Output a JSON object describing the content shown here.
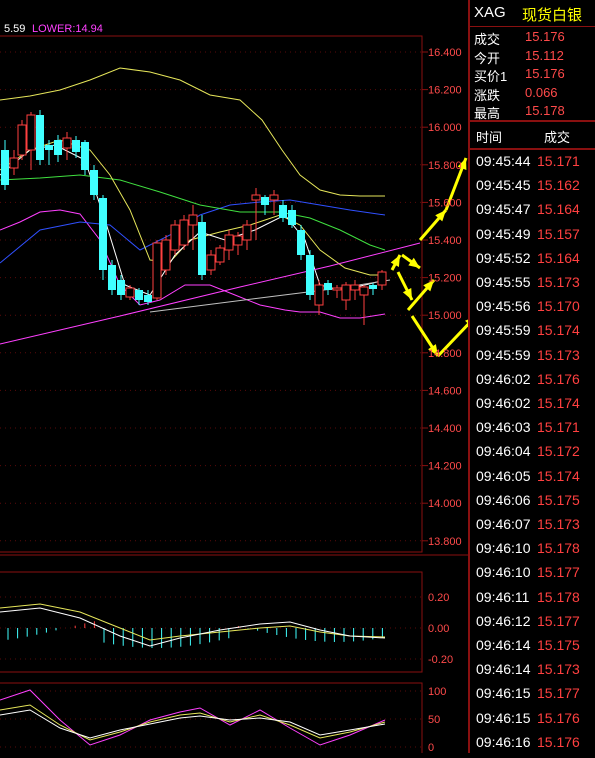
{
  "indicator_legend": {
    "mid_value": "5.59",
    "lower": "LOWER:14.94"
  },
  "price_axis": [
    "16.400",
    "16.200",
    "16.000",
    "15.800",
    "15.600",
    "15.400",
    "15.200",
    "15.000",
    "14.800",
    "14.600",
    "14.400",
    "14.200",
    "14.000",
    "13.800"
  ],
  "macd_axis": [
    "0.20",
    "0.00",
    "-0.20"
  ],
  "kdj_axis": [
    "100",
    "50",
    "0"
  ],
  "header": {
    "code": "XAG",
    "name": "现货白银"
  },
  "quote": [
    {
      "label": "成交",
      "value": "15.176"
    },
    {
      "label": "今开",
      "value": "15.112"
    },
    {
      "label": "买价1",
      "value": "15.176"
    },
    {
      "label": "涨跌",
      "value": "0.066"
    },
    {
      "label": "最高",
      "value": "15.178"
    }
  ],
  "ticks_header": {
    "time": "时间",
    "price": "成交"
  },
  "ticks": [
    {
      "time": "09:45:44",
      "price": "15.171"
    },
    {
      "time": "09:45:45",
      "price": "15.162"
    },
    {
      "time": "09:45:47",
      "price": "15.164"
    },
    {
      "time": "09:45:49",
      "price": "15.157"
    },
    {
      "time": "09:45:52",
      "price": "15.164"
    },
    {
      "time": "09:45:55",
      "price": "15.173"
    },
    {
      "time": "09:45:56",
      "price": "15.170"
    },
    {
      "time": "09:45:59",
      "price": "15.174"
    },
    {
      "time": "09:45:59",
      "price": "15.173"
    },
    {
      "time": "09:46:02",
      "price": "15.176"
    },
    {
      "time": "09:46:02",
      "price": "15.174"
    },
    {
      "time": "09:46:03",
      "price": "15.171"
    },
    {
      "time": "09:46:04",
      "price": "15.172"
    },
    {
      "time": "09:46:05",
      "price": "15.174"
    },
    {
      "time": "09:46:06",
      "price": "15.175"
    },
    {
      "time": "09:46:07",
      "price": "15.173"
    },
    {
      "time": "09:46:10",
      "price": "15.178"
    },
    {
      "time": "09:46:10",
      "price": "15.177"
    },
    {
      "time": "09:46:11",
      "price": "15.178"
    },
    {
      "time": "09:46:12",
      "price": "15.177"
    },
    {
      "time": "09:46:14",
      "price": "15.175"
    },
    {
      "time": "09:46:14",
      "price": "15.173"
    },
    {
      "time": "09:46:15",
      "price": "15.177"
    },
    {
      "time": "09:46:15",
      "price": "15.176"
    },
    {
      "time": "09:46:16",
      "price": "15.176"
    }
  ],
  "colors": {
    "frame": "#8a1010",
    "up": "#ff4040",
    "down": "#40ffff",
    "label": "#ffffff",
    "accent": "#ffff00"
  }
}
